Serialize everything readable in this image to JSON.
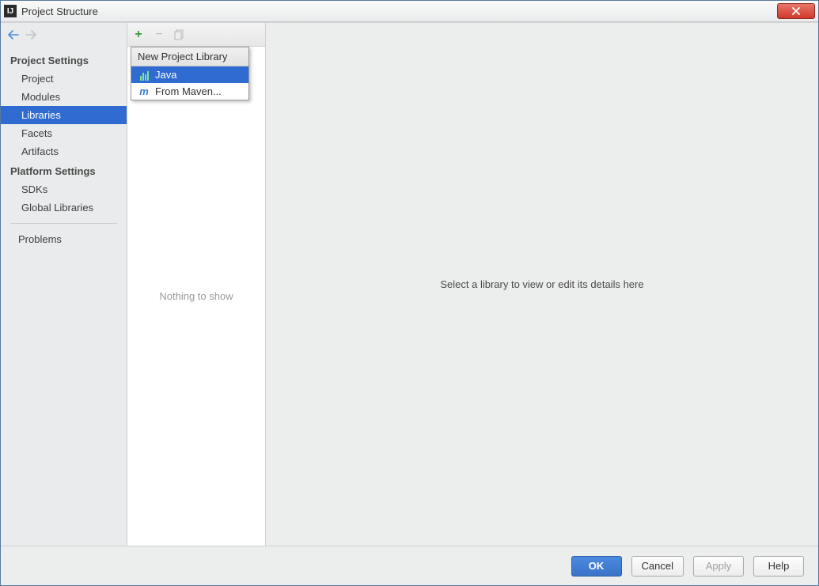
{
  "window": {
    "title": "Project Structure",
    "icon_text": "IJ"
  },
  "nav": {
    "back_enabled": true,
    "forward_enabled": false
  },
  "sidebar": {
    "section1_title": "Project Settings",
    "section2_title": "Platform Settings",
    "items1": [
      "Project",
      "Modules",
      "Libraries",
      "Facets",
      "Artifacts"
    ],
    "items2": [
      "SDKs",
      "Global Libraries"
    ],
    "selected": "Libraries",
    "problems_label": "Problems"
  },
  "midcol": {
    "empty_text": "Nothing to show"
  },
  "dropdown": {
    "header": "New Project Library",
    "items": [
      {
        "label": "Java",
        "icon": "bars"
      },
      {
        "label": "From Maven...",
        "icon": "m"
      }
    ],
    "selected": "Java"
  },
  "main": {
    "placeholder": "Select a library to view or edit its details here"
  },
  "buttons": {
    "ok": "OK",
    "cancel": "Cancel",
    "apply": "Apply",
    "help": "Help"
  }
}
